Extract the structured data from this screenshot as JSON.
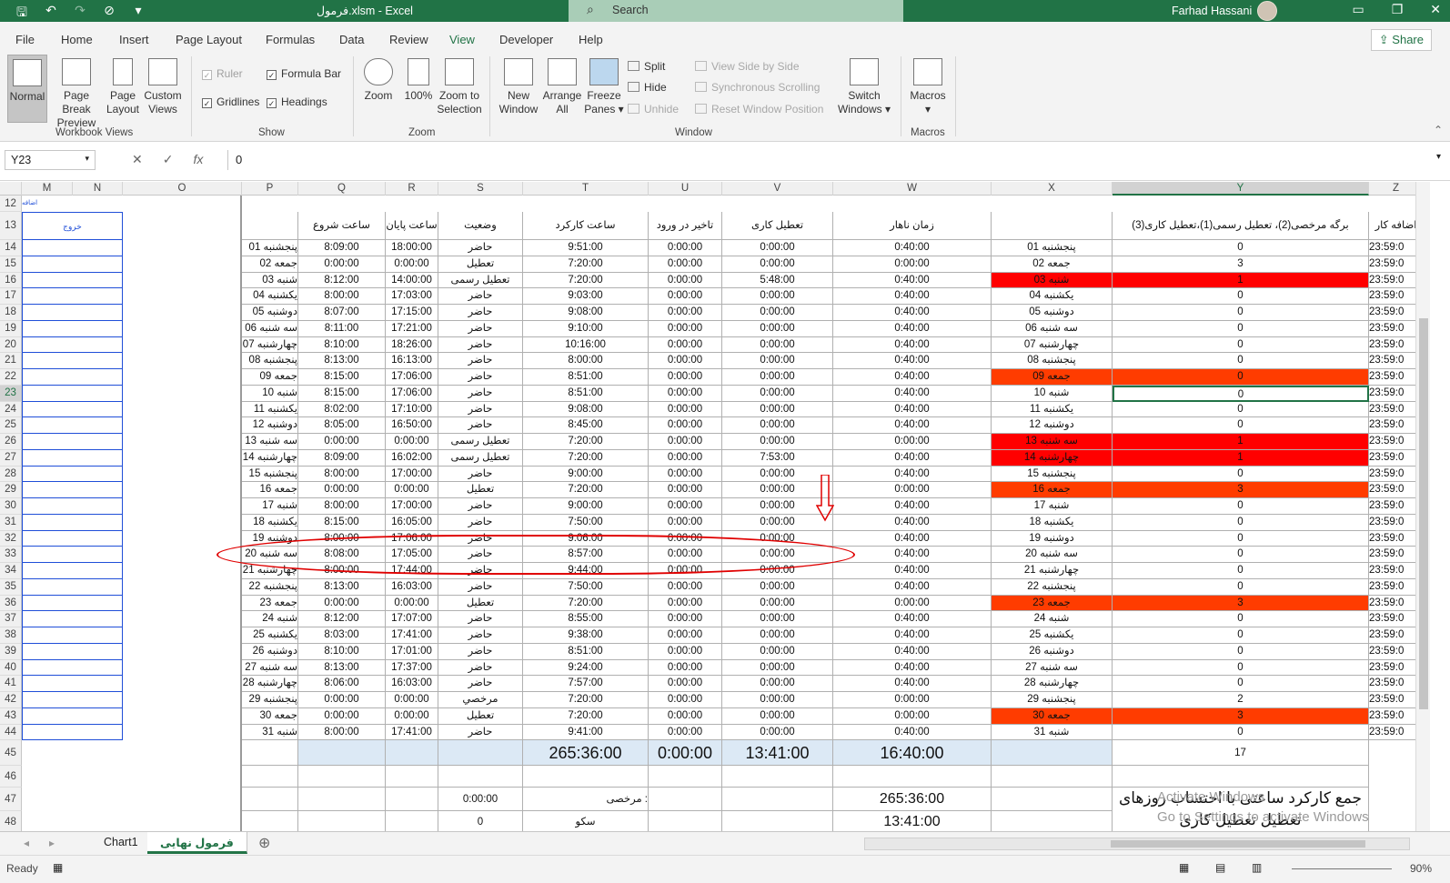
{
  "app": {
    "title": "فرمول.xlsm  -  Excel",
    "search_placeholder": "Search",
    "user": "Farhad Hassani",
    "share_label": "Share"
  },
  "menu": [
    "File",
    "Home",
    "Insert",
    "Page Layout",
    "Formulas",
    "Data",
    "Review",
    "View",
    "Developer",
    "Help"
  ],
  "ribbon": {
    "workbook_views": {
      "group": "Workbook Views",
      "buttons": [
        "Normal",
        "Page Break Preview",
        "Page Layout",
        "Custom Views"
      ]
    },
    "show": {
      "group": "Show",
      "ruler": "Ruler",
      "formula_bar": "Formula Bar",
      "gridlines": "Gridlines",
      "headings": "Headings"
    },
    "zoom": {
      "group": "Zoom",
      "buttons": [
        "Zoom",
        "100%",
        "Zoom to Selection"
      ]
    },
    "window": {
      "group": "Window",
      "new_window": "New Window",
      "arrange_all": "Arrange All",
      "freeze_panes": "Freeze Panes",
      "split": "Split",
      "hide": "Hide",
      "unhide": "Unhide",
      "side_by_side": "View Side by Side",
      "sync_scroll": "Synchronous Scrolling",
      "reset_position": "Reset Window Position",
      "switch_windows": "Switch Windows"
    },
    "macros": {
      "group": "Macros",
      "button": "Macros"
    }
  },
  "formula_bar": {
    "name_box": "Y23",
    "content": "0"
  },
  "columns": [
    "M",
    "N",
    "O",
    "P",
    "Q",
    "R",
    "S",
    "T",
    "U",
    "V",
    "W",
    "X",
    "Y",
    "Z"
  ],
  "headers_row13": {
    "M": "خروج",
    "M12": "اضافه",
    "Q": "ساعت شروع",
    "R": "ساعت پایان",
    "S": "وضعیت",
    "T": "ساعت  کارکرد",
    "U": "تاخیر در ورود",
    "V": "تعطیل کاری",
    "W": "زمان ناهار",
    "Y": "برگه مرخصی(2)، تعطیل رسمی(1)،تعطیل کاری(3)",
    "Z": "اضافه کار"
  },
  "rows": [
    {
      "n": "14",
      "P": "پنجشنبه 01",
      "Q": "8:09:00",
      "R": "18:00:00",
      "S": "حاضر",
      "T": "9:51:00",
      "U": "0:00:00",
      "V": "0:00:00",
      "W": "0:40:00",
      "X": "پنجشنبه 01",
      "Y": "0",
      "Z": "23:59:0",
      "fill": ""
    },
    {
      "n": "15",
      "P": "جمعه 02",
      "Q": "0:00:00",
      "R": "0:00:00",
      "S": "تعطیل",
      "T": "7:20:00",
      "U": "0:00:00",
      "V": "0:00:00",
      "W": "0:00:00",
      "X": "جمعه 02",
      "Y": "3",
      "Z": "23:59:0",
      "fill": ""
    },
    {
      "n": "16",
      "P": "شنبه 03",
      "Q": "8:12:00",
      "R": "14:00:00",
      "S": "تعطیل رسمی",
      "T": "7:20:00",
      "U": "0:00:00",
      "V": "5:48:00",
      "W": "0:40:00",
      "X": "شنبه 03",
      "Y": "1",
      "Z": "23:59:0",
      "fill": "red"
    },
    {
      "n": "17",
      "P": "یکشنبه 04",
      "Q": "8:00:00",
      "R": "17:03:00",
      "S": "حاضر",
      "T": "9:03:00",
      "U": "0:00:00",
      "V": "0:00:00",
      "W": "0:40:00",
      "X": "یکشنبه 04",
      "Y": "0",
      "Z": "23:59:0",
      "fill": ""
    },
    {
      "n": "18",
      "P": "دوشنبه 05",
      "Q": "8:07:00",
      "R": "17:15:00",
      "S": "حاضر",
      "T": "9:08:00",
      "U": "0:00:00",
      "V": "0:00:00",
      "W": "0:40:00",
      "X": "دوشنبه 05",
      "Y": "0",
      "Z": "23:59:0",
      "fill": ""
    },
    {
      "n": "19",
      "P": "سه شنبه 06",
      "Q": "8:11:00",
      "R": "17:21:00",
      "S": "حاضر",
      "T": "9:10:00",
      "U": "0:00:00",
      "V": "0:00:00",
      "W": "0:40:00",
      "X": "سه شنبه 06",
      "Y": "0",
      "Z": "23:59:0",
      "fill": ""
    },
    {
      "n": "20",
      "P": "چهارشنبه 07",
      "Q": "8:10:00",
      "R": "18:26:00",
      "S": "حاضر",
      "T": "10:16:00",
      "U": "0:00:00",
      "V": "0:00:00",
      "W": "0:40:00",
      "X": "چهارشنبه 07",
      "Y": "0",
      "Z": "23:59:0",
      "fill": ""
    },
    {
      "n": "21",
      "P": "پنجشنبه 08",
      "Q": "8:13:00",
      "R": "16:13:00",
      "S": "حاضر",
      "T": "8:00:00",
      "U": "0:00:00",
      "V": "0:00:00",
      "W": "0:40:00",
      "X": "پنجشنبه 08",
      "Y": "0",
      "Z": "23:59:0",
      "fill": ""
    },
    {
      "n": "22",
      "P": "جمعه 09",
      "Q": "8:15:00",
      "R": "17:06:00",
      "S": "حاضر",
      "T": "8:51:00",
      "U": "0:00:00",
      "V": "0:00:00",
      "W": "0:40:00",
      "X": "جمعه 09",
      "Y": "0",
      "Z": "23:59:0",
      "fill": "org"
    },
    {
      "n": "23",
      "P": "شنبه 10",
      "Q": "8:15:00",
      "R": "17:06:00",
      "S": "حاضر",
      "T": "8:51:00",
      "U": "0:00:00",
      "V": "0:00:00",
      "W": "0:40:00",
      "X": "شنبه 10",
      "Y": "0",
      "Z": "23:59:0",
      "fill": "sel"
    },
    {
      "n": "24",
      "P": "یکشنبه 11",
      "Q": "8:02:00",
      "R": "17:10:00",
      "S": "حاضر",
      "T": "9:08:00",
      "U": "0:00:00",
      "V": "0:00:00",
      "W": "0:40:00",
      "X": "یکشنبه 11",
      "Y": "0",
      "Z": "23:59:0",
      "fill": ""
    },
    {
      "n": "25",
      "P": "دوشنبه 12",
      "Q": "8:05:00",
      "R": "16:50:00",
      "S": "حاضر",
      "T": "8:45:00",
      "U": "0:00:00",
      "V": "0:00:00",
      "W": "0:40:00",
      "X": "دوشنبه 12",
      "Y": "0",
      "Z": "23:59:0",
      "fill": ""
    },
    {
      "n": "26",
      "P": "سه شنبه 13",
      "Q": "0:00:00",
      "R": "0:00:00",
      "S": "تعطیل رسمی",
      "T": "7:20:00",
      "U": "0:00:00",
      "V": "0:00:00",
      "W": "0:00:00",
      "X": "سه شنبه 13",
      "Y": "1",
      "Z": "23:59:0",
      "fill": "red"
    },
    {
      "n": "27",
      "P": "چهارشنبه 14",
      "Q": "8:09:00",
      "R": "16:02:00",
      "S": "تعطیل رسمی",
      "T": "7:20:00",
      "U": "0:00:00",
      "V": "7:53:00",
      "W": "0:40:00",
      "X": "چهارشنبه 14",
      "Y": "1",
      "Z": "23:59:0",
      "fill": "red"
    },
    {
      "n": "28",
      "P": "پنجشنبه 15",
      "Q": "8:00:00",
      "R": "17:00:00",
      "S": "حاضر",
      "T": "9:00:00",
      "U": "0:00:00",
      "V": "0:00:00",
      "W": "0:40:00",
      "X": "پنجشنبه 15",
      "Y": "0",
      "Z": "23:59:0",
      "fill": ""
    },
    {
      "n": "29",
      "P": "جمعه 16",
      "Q": "0:00:00",
      "R": "0:00:00",
      "S": "تعطیل",
      "T": "7:20:00",
      "U": "0:00:00",
      "V": "0:00:00",
      "W": "0:00:00",
      "X": "جمعه 16",
      "Y": "3",
      "Z": "23:59:0",
      "fill": "org"
    },
    {
      "n": "30",
      "P": "شنبه 17",
      "Q": "8:00:00",
      "R": "17:00:00",
      "S": "حاضر",
      "T": "9:00:00",
      "U": "0:00:00",
      "V": "0:00:00",
      "W": "0:40:00",
      "X": "شنبه 17",
      "Y": "0",
      "Z": "23:59:0",
      "fill": ""
    },
    {
      "n": "31",
      "P": "یکشنبه 18",
      "Q": "8:15:00",
      "R": "16:05:00",
      "S": "حاضر",
      "T": "7:50:00",
      "U": "0:00:00",
      "V": "0:00:00",
      "W": "0:40:00",
      "X": "یکشنبه 18",
      "Y": "0",
      "Z": "23:59:0",
      "fill": ""
    },
    {
      "n": "32",
      "P": "دوشنبه 19",
      "Q": "8:00:00",
      "R": "17:06:00",
      "S": "حاضر",
      "T": "9:06:00",
      "U": "0:00:00",
      "V": "0:00:00",
      "W": "0:40:00",
      "X": "دوشنبه 19",
      "Y": "0",
      "Z": "23:59:0",
      "fill": ""
    },
    {
      "n": "33",
      "P": "سه شنبه 20",
      "Q": "8:08:00",
      "R": "17:05:00",
      "S": "حاضر",
      "T": "8:57:00",
      "U": "0:00:00",
      "V": "0:00:00",
      "W": "0:40:00",
      "X": "سه شنبه 20",
      "Y": "0",
      "Z": "23:59:0",
      "fill": ""
    },
    {
      "n": "34",
      "P": "چهارشنبه 21",
      "Q": "8:00:00",
      "R": "17:44:00",
      "S": "حاضر",
      "T": "9:44:00",
      "U": "0:00:00",
      "V": "0:00:00",
      "W": "0:40:00",
      "X": "چهارشنبه 21",
      "Y": "0",
      "Z": "23:59:0",
      "fill": ""
    },
    {
      "n": "35",
      "P": "پنجشنبه 22",
      "Q": "8:13:00",
      "R": "16:03:00",
      "S": "حاضر",
      "T": "7:50:00",
      "U": "0:00:00",
      "V": "0:00:00",
      "W": "0:40:00",
      "X": "پنجشنبه 22",
      "Y": "0",
      "Z": "23:59:0",
      "fill": ""
    },
    {
      "n": "36",
      "P": "جمعه 23",
      "Q": "0:00:00",
      "R": "0:00:00",
      "S": "تعطیل",
      "T": "7:20:00",
      "U": "0:00:00",
      "V": "0:00:00",
      "W": "0:00:00",
      "X": "جمعه 23",
      "Y": "3",
      "Z": "23:59:0",
      "fill": "org"
    },
    {
      "n": "37",
      "P": "شنبه 24",
      "Q": "8:12:00",
      "R": "17:07:00",
      "S": "حاضر",
      "T": "8:55:00",
      "U": "0:00:00",
      "V": "0:00:00",
      "W": "0:40:00",
      "X": "شنبه 24",
      "Y": "0",
      "Z": "23:59:0",
      "fill": ""
    },
    {
      "n": "38",
      "P": "یکشنبه 25",
      "Q": "8:03:00",
      "R": "17:41:00",
      "S": "حاضر",
      "T": "9:38:00",
      "U": "0:00:00",
      "V": "0:00:00",
      "W": "0:40:00",
      "X": "یکشنبه 25",
      "Y": "0",
      "Z": "23:59:0",
      "fill": ""
    },
    {
      "n": "39",
      "P": "دوشنبه 26",
      "Q": "8:10:00",
      "R": "17:01:00",
      "S": "حاضر",
      "T": "8:51:00",
      "U": "0:00:00",
      "V": "0:00:00",
      "W": "0:40:00",
      "X": "دوشنبه 26",
      "Y": "0",
      "Z": "23:59:0",
      "fill": ""
    },
    {
      "n": "40",
      "P": "سه شنبه 27",
      "Q": "8:13:00",
      "R": "17:37:00",
      "S": "حاضر",
      "T": "9:24:00",
      "U": "0:00:00",
      "V": "0:00:00",
      "W": "0:40:00",
      "X": "سه شنبه 27",
      "Y": "0",
      "Z": "23:59:0",
      "fill": ""
    },
    {
      "n": "41",
      "P": "چهارشنبه 28",
      "Q": "8:06:00",
      "R": "16:03:00",
      "S": "حاضر",
      "T": "7:57:00",
      "U": "0:00:00",
      "V": "0:00:00",
      "W": "0:40:00",
      "X": "چهارشنبه 28",
      "Y": "0",
      "Z": "23:59:0",
      "fill": ""
    },
    {
      "n": "42",
      "P": "پنجشنبه 29",
      "Q": "0:00:00",
      "R": "0:00:00",
      "S": "مرخصي",
      "T": "7:20:00",
      "U": "0:00:00",
      "V": "0:00:00",
      "W": "0:00:00",
      "X": "پنجشنبه 29",
      "Y": "2",
      "Z": "23:59:0",
      "fill": ""
    },
    {
      "n": "43",
      "P": "جمعه 30",
      "Q": "0:00:00",
      "R": "0:00:00",
      "S": "تعطیل",
      "T": "7:20:00",
      "U": "0:00:00",
      "V": "0:00:00",
      "W": "0:00:00",
      "X": "جمعه 30",
      "Y": "3",
      "Z": "23:59:0",
      "fill": "org"
    },
    {
      "n": "44",
      "P": "شنبه 31",
      "Q": "8:00:00",
      "R": "17:41:00",
      "S": "حاضر",
      "T": "9:41:00",
      "U": "0:00:00",
      "V": "0:00:00",
      "W": "0:40:00",
      "X": "شنبه 31",
      "Y": "0",
      "Z": "23:59:0",
      "fill": ""
    }
  ],
  "totals": {
    "T": "265:36:00",
    "U": "0:00:00",
    "V": "13:41:00",
    "W": "16:40:00",
    "Y": "17"
  },
  "summary": {
    "S47": "0:00:00",
    "T47": "مرخصی :",
    "W47": "265:36:00",
    "S48": "0",
    "T48": "سکو",
    "W48": "13:41:00",
    "Y47": "جمع کارکرد ساعتی با احتساب روزهای تعطیل تعطیل کاری"
  },
  "watermark": [
    "Activate Windows",
    "Go to Settings to activate Windows"
  ],
  "extra_row_labels": [
    "12",
    "13",
    "45",
    "46",
    "47",
    "48"
  ],
  "sheet_tabs": [
    "Chart1",
    "فرمول نهایی"
  ],
  "status": {
    "ready": "Ready",
    "zoom": "90%"
  },
  "colors": {
    "excel_green": "#217346",
    "holiday_red": "#ff0000",
    "friday_orange": "#ff3c00",
    "annotation_red": "#e00000"
  }
}
